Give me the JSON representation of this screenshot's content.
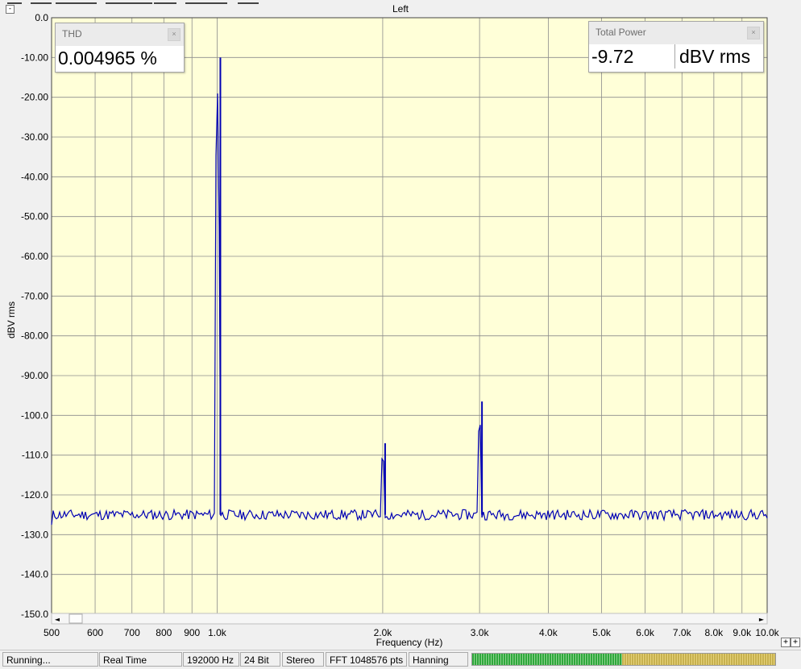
{
  "window": {
    "collapse_label": "-"
  },
  "chart_title": "Left",
  "widgets": {
    "thd": {
      "title": "THD",
      "value": "0.004965 %",
      "close": "×"
    },
    "power": {
      "title": "Total Power",
      "value": "-9.72",
      "unit": "dBV rms",
      "close": "×"
    }
  },
  "scrollbar": {
    "left_arrow": "◄",
    "right_arrow": "►"
  },
  "zoom": {
    "in": "+",
    "out": "+"
  },
  "status": {
    "state": "Running...",
    "mode": "Real Time",
    "sample_rate": "192000 Hz",
    "bits": "24 Bit",
    "channels": "Stereo",
    "fft": "FFT 1048576 pts",
    "window": "Hanning"
  },
  "colors": {
    "plot_bg": "#ffffd8",
    "trace": "#0000b4",
    "grid": "#8c8c8c"
  },
  "chart_data": {
    "type": "line",
    "title": "Left",
    "xlabel": "Frequency (Hz)",
    "ylabel": "dBV rms",
    "xscale": "log",
    "xlim": [
      500,
      10000
    ],
    "ylim": [
      -150,
      0
    ],
    "grid": true,
    "yticks": [
      0,
      -10,
      -20,
      -30,
      -40,
      -50,
      -60,
      -70,
      -80,
      -90,
      -100,
      -110,
      -120,
      -130,
      -140,
      -150
    ],
    "ytick_labels": [
      "0.0",
      "-10.00",
      "-20.00",
      "-30.00",
      "-40.00",
      "-50.00",
      "-60.00",
      "-70.00",
      "-80.00",
      "-90.00",
      "-100.0",
      "-110.0",
      "-120.0",
      "-130.0",
      "-140.0",
      "-150.0"
    ],
    "xticks": [
      500,
      600,
      700,
      800,
      900,
      1000,
      2000,
      3000,
      4000,
      5000,
      6000,
      7000,
      8000,
      9000,
      10000
    ],
    "xtick_labels": [
      "500",
      "600",
      "700",
      "800",
      "900",
      "1.0k",
      "2.0k",
      "3.0k",
      "4.0k",
      "5.0k",
      "6.0k",
      "7.0k",
      "8.0k",
      "9.0k",
      "10.0k"
    ],
    "noise_floor": -125,
    "peaks": [
      {
        "x": 1000,
        "y": -10
      },
      {
        "x": 2000,
        "y": -107
      },
      {
        "x": 3000,
        "y": -96.5
      }
    ]
  }
}
